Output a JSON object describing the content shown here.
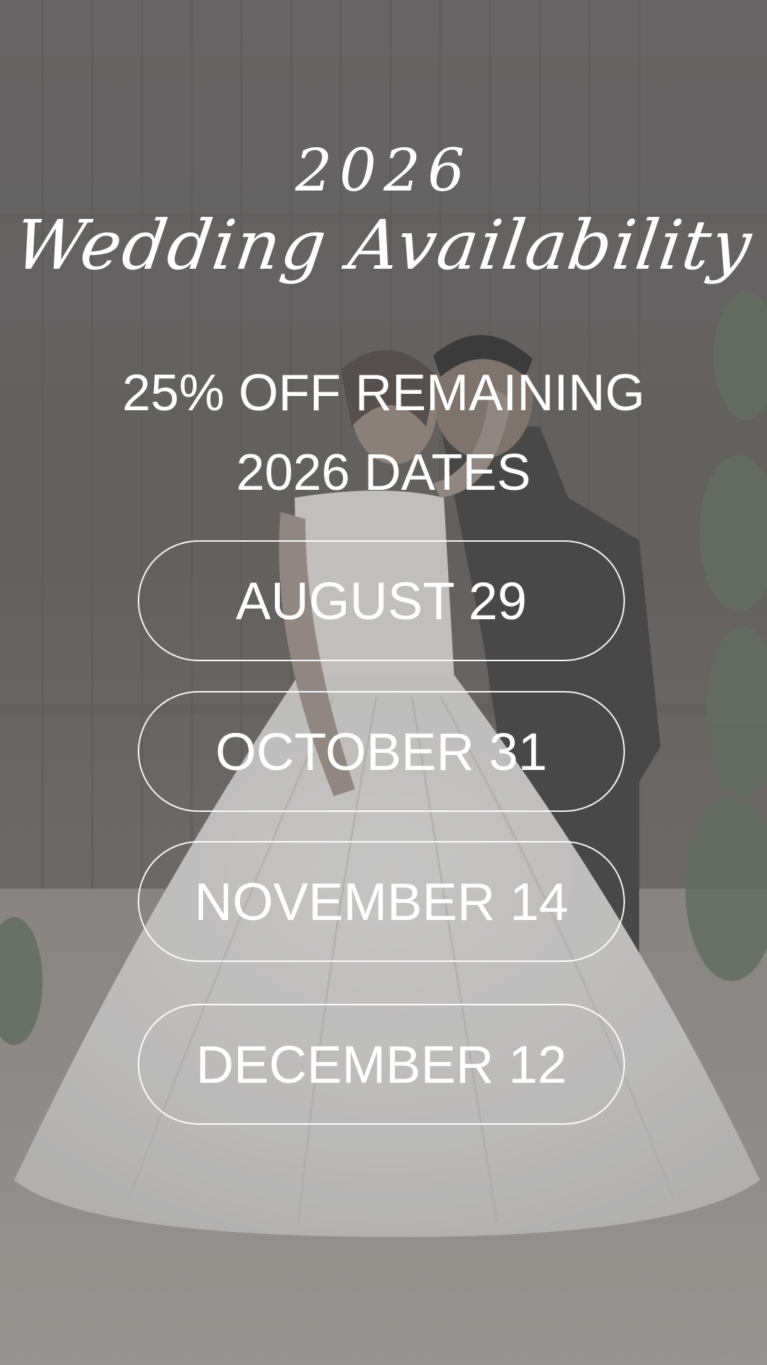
{
  "header": {
    "year": "2026",
    "title": "Wedding Availability"
  },
  "promo": {
    "line1": "25% OFF REMAINING",
    "line2": "2026 DATES"
  },
  "dates": [
    "AUGUST 29",
    "OCTOBER 31",
    "NOVEMBER 14",
    "DECEMBER 12"
  ],
  "colors": {
    "text": "#ffffff",
    "background_tint": "#6b6a69"
  }
}
